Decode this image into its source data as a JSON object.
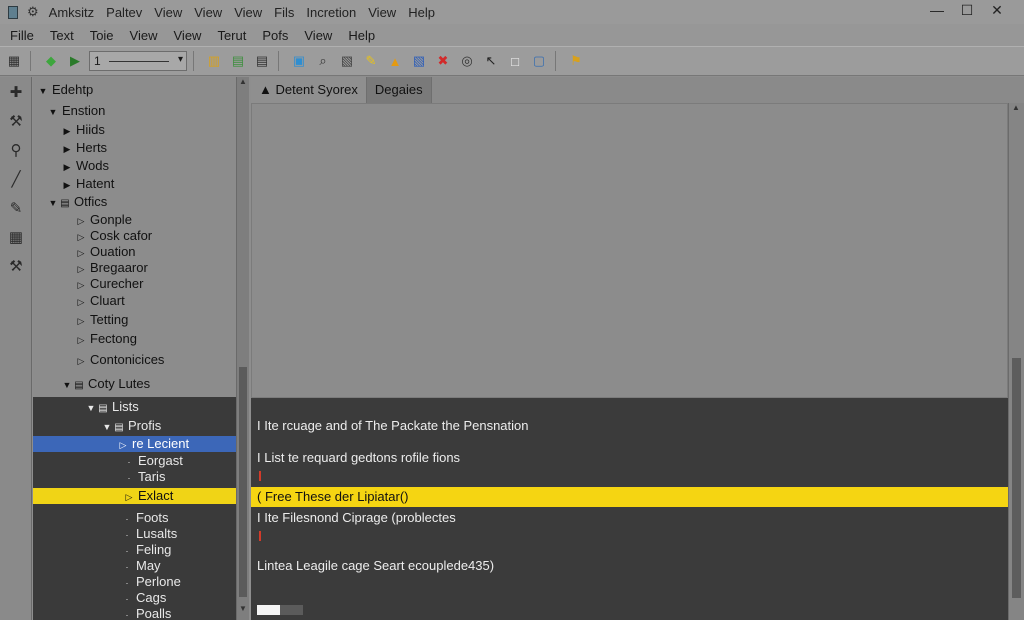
{
  "window": {
    "title_menu": [
      "Amksitz",
      "Paltev",
      "View",
      "View",
      "View",
      "Fils",
      "Incretion",
      "View",
      "Help"
    ],
    "controls": [
      "—",
      "☐",
      "✕"
    ]
  },
  "menubar": [
    "Fille",
    "Text",
    "Toie",
    "View",
    "View",
    "Terut",
    "Pofs",
    "View",
    "Help"
  ],
  "toolbar": {
    "combo_value": "1",
    "icons": [
      "new-file-icon",
      "run-icon",
      "play-icon",
      "library-icon",
      "stack-icon",
      "list-icon",
      "image-icon",
      "search-icon",
      "clipboard-icon",
      "pencil-icon",
      "warning-icon",
      "badge-icon",
      "error-icon",
      "target-icon",
      "arrow-icon",
      "frame-icon",
      "monitor-icon",
      "network-icon"
    ],
    "icon_glyphs": [
      "▦",
      "◆",
      "▶",
      "▥",
      "▤",
      "▤",
      "▣",
      "⌕",
      "▧",
      "✎",
      "▲",
      "▧",
      "✖",
      "◎",
      "↖",
      "□",
      "▢",
      "⚑"
    ],
    "icon_colors": [
      "#2f2f2f",
      "#3da63d",
      "#2a7a2a",
      "#d8a11c",
      "#3f8f3f",
      "#333333",
      "#2f8ed0",
      "#333333",
      "#444444",
      "#e8c21a",
      "#e59a10",
      "#2f5fb8",
      "#d22a2a",
      "#333333",
      "#222222",
      "#f2f2f2",
      "#3a6fb0",
      "#d8a11c"
    ]
  },
  "left_strip_icons": [
    "plus-icon",
    "wrench-icon",
    "hook-icon",
    "brush-icon",
    "pen-icon",
    "grid-icon",
    "hammer-icon"
  ],
  "left_strip_glyphs": [
    "✚",
    "⚒",
    "⚲",
    "╱",
    "✎",
    "▦",
    "⚒"
  ],
  "tree": [
    {
      "label": "Edehtp",
      "twisty": "▼",
      "icon": "",
      "style": "normal"
    },
    {
      "label": "Enstion",
      "twisty": "▼",
      "icon": "",
      "style": "normal"
    },
    {
      "label": "Hiids",
      "twisty": "▶",
      "icon": "",
      "style": "normal"
    },
    {
      "label": "Herts",
      "twisty": "▶",
      "icon": "",
      "style": "normal"
    },
    {
      "label": "Wods",
      "twisty": "▶",
      "icon": "",
      "style": "normal"
    },
    {
      "label": "Hatent",
      "twisty": "▶",
      "icon": "",
      "style": "normal"
    },
    {
      "label": "Otfics",
      "twisty": "▼",
      "icon": "▤",
      "style": "normal"
    },
    {
      "label": "Gonple",
      "twisty": "▷",
      "icon": "",
      "style": "normal"
    },
    {
      "label": "Cosk cafor",
      "twisty": "▷",
      "icon": "",
      "style": "normal"
    },
    {
      "label": "Ouation",
      "twisty": "▷",
      "icon": "",
      "style": "normal"
    },
    {
      "label": "Bregaaror",
      "twisty": "▷",
      "icon": "",
      "style": "normal"
    },
    {
      "label": "Curecher",
      "twisty": "▷",
      "icon": "",
      "style": "normal"
    },
    {
      "label": "Cluart",
      "twisty": "▷",
      "icon": "",
      "style": "normal"
    },
    {
      "label": "Tetting",
      "twisty": "▷",
      "icon": "",
      "style": "normal"
    },
    {
      "label": "Fectong",
      "twisty": "▷",
      "icon": "",
      "style": "normal"
    },
    {
      "label": "Contonicices",
      "twisty": "▷",
      "icon": "",
      "style": "normal"
    },
    {
      "label": "Coty Lutes",
      "twisty": "▼",
      "icon": "▤",
      "style": "normal"
    },
    {
      "label": "Lists",
      "twisty": "▼",
      "icon": "▤",
      "style": "dark"
    },
    {
      "label": "Profis",
      "twisty": "▼",
      "icon": "▤",
      "style": "dark"
    },
    {
      "label": "re Lecient",
      "twisty": "▷",
      "icon": "",
      "style": "selected"
    },
    {
      "label": "Eorgast",
      "twisty": "·",
      "icon": "",
      "style": "dark"
    },
    {
      "label": "Taris",
      "twisty": "·",
      "icon": "",
      "style": "dark"
    },
    {
      "label": "Exlact",
      "twisty": "▷",
      "icon": "",
      "style": "highlight"
    },
    {
      "label": "Foots",
      "twisty": "·",
      "icon": "",
      "style": "dark"
    },
    {
      "label": "Lusalts",
      "twisty": "·",
      "icon": "",
      "style": "dark"
    },
    {
      "label": "Feling",
      "twisty": "·",
      "icon": "",
      "style": "dark"
    },
    {
      "label": "May",
      "twisty": "·",
      "icon": "",
      "style": "dark"
    },
    {
      "label": "Perlone",
      "twisty": "·",
      "icon": "",
      "style": "dark"
    },
    {
      "label": "Cags",
      "twisty": "·",
      "icon": "",
      "style": "dark"
    },
    {
      "label": "Poalls",
      "twisty": "·",
      "icon": "",
      "style": "dark"
    }
  ],
  "tabs": [
    {
      "label": "Detent Syorex",
      "icon": "▲",
      "active": true
    },
    {
      "label": "Degaies",
      "icon": "",
      "active": false
    }
  ],
  "editor": {
    "lines": [
      "I Ite rcuage and of The Packate the Pensnation",
      "I List te requard gedtons rofile fions",
      "( Free These der Lipiatar()",
      "I Ite Filesnond Ciprage (problectes",
      "Lintea Leagile cage Seart ecouplede435)"
    ],
    "highlight_index": 2,
    "progress": 0.5
  }
}
